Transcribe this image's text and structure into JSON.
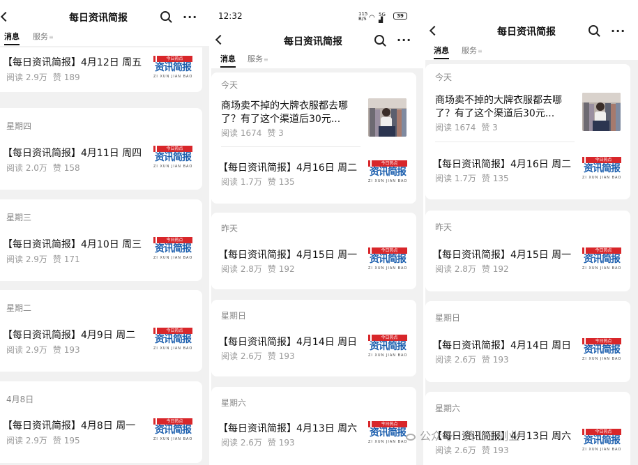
{
  "account_title": "每日资讯简报",
  "tabs": {
    "messages": "消息",
    "services": "服务",
    "services_mark": "≡"
  },
  "status": {
    "time": "12:32",
    "net": "115 B/S",
    "signal": "5G",
    "battery": "39"
  },
  "logo": {
    "tag": "今日热点",
    "main": "资讯简报",
    "sub": "ZI XUN JIAN BAO"
  },
  "stats_prefix": {
    "read": "阅读",
    "like": "赞"
  },
  "panel1": {
    "items": [
      {
        "day": "",
        "head": "【每日资讯简报】4月12日 周五",
        "reads": "阅读 2.9万",
        "likes": "赞 189"
      },
      {
        "day": "星期四",
        "head": "【每日资讯简报】4月11日 周四",
        "reads": "阅读 2.0万",
        "likes": "赞 158"
      },
      {
        "day": "星期三",
        "head": "【每日资讯简报】4月10日 周三",
        "reads": "阅读 2.9万",
        "likes": "赞 171"
      },
      {
        "day": "星期二",
        "head": "【每日资讯简报】4月9日 周二",
        "reads": "阅读 2.9万",
        "likes": "赞 193"
      },
      {
        "day": "4月8日",
        "head": "【每日资讯简报】4月8日 周一",
        "reads": "阅读 2.9万",
        "likes": "赞 195"
      }
    ]
  },
  "panel2": {
    "today": "今天",
    "promo": {
      "line1": "商场卖不掉的大牌衣服都去哪",
      "line2": "了？有了这个渠道后30元...",
      "reads": "阅读 1674",
      "likes": "赞 3"
    },
    "items": [
      {
        "day": "",
        "head": "【每日资讯简报】4月16日 周二",
        "reads": "阅读 1.7万",
        "likes": "赞 135"
      },
      {
        "day": "昨天",
        "head": "【每日资讯简报】4月15日 周一",
        "reads": "阅读 2.8万",
        "likes": "赞 192"
      },
      {
        "day": "星期日",
        "head": "【每日资讯简报】4月14日 周日",
        "reads": "阅读 2.6万",
        "likes": "赞 193"
      },
      {
        "day": "星期六",
        "head": "【每日资讯简报】4月13日 周六",
        "reads": "阅读 2.6万",
        "likes": "赞 193"
      }
    ]
  },
  "panel3": {
    "today": "今天",
    "promo": {
      "line1": "商场卖不掉的大牌衣服都去哪",
      "line2": "了？有了这个渠道后30元...",
      "reads": "阅读 1674",
      "likes": "赞 3"
    },
    "items": [
      {
        "day": "",
        "head": "【每日资讯简报】4月16日 周二",
        "reads": "阅读 1.7万",
        "likes": "赞 135"
      },
      {
        "day": "昨天",
        "head": "【每日资讯简报】4月15日 周一",
        "reads": "阅读 2.8万",
        "likes": "赞 192"
      },
      {
        "day": "星期日",
        "head": "【每日资讯简报】4月14日 周日",
        "reads": "阅读 2.6万",
        "likes": "赞 193"
      },
      {
        "day": "星期六",
        "head": "【每日资讯简报】4月13日 周六",
        "reads": "阅读 2.6万",
        "likes": "赞 193"
      }
    ]
  },
  "watermark": "公众号 · 黄山王副业",
  "colors": {
    "logo_red": "#d8262a",
    "logo_blue": "#1c5fae",
    "background": "#f1f1f1"
  }
}
